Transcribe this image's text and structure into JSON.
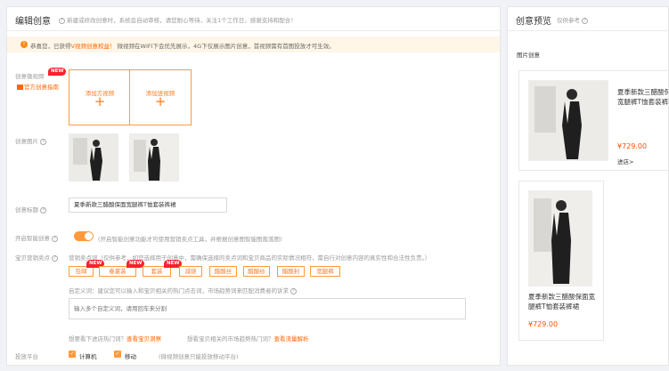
{
  "left": {
    "title": "编辑创意",
    "desc": "新建或修改创意时，系统会自动审核，请您耐心等待，关注1个工作日，感谢支持和配合！",
    "notice": {
      "pre": "恭喜您，已获得",
      "vip": "V视频",
      "vip_tail": "创意权益！",
      "body": "微视频在WIFI下会优先展示，4G下仅展示图片创意，首视频需有首图投放才可生效。"
    },
    "video": {
      "label": "创意微视频",
      "badge": "NEW",
      "guide": "官方创意指南",
      "add_square": "添加方视频",
      "add_vertical": "添加竖视频",
      "plus": "+"
    },
    "images": {
      "label": "创意图片"
    },
    "title_field": {
      "label": "创意标题",
      "value": "夏季新款三醋酸保面宽腿裤T恤套装裤裙"
    },
    "smart": {
      "label": "开启智能创意",
      "desc": "(开启智能创意功能才可使用营销卖点工具，并根据创意图智能图裁落图)"
    },
    "selling": {
      "label": "宝贝营销卖点",
      "hint_label": "营销卖点词",
      "hint": "（仅供参考，如您选择用于创意中，需确保选择的卖点词和宝贝商品的实际情况相符，需自行对创意内容的真实性和合法性负责。）",
      "tags": [
        {
          "text": "包邮",
          "badge": "NEW"
        },
        {
          "text": "春夏装",
          "badge": "NEW"
        },
        {
          "text": "套装",
          "badge": "NEW"
        },
        {
          "text": "减烧",
          "badge": ""
        },
        {
          "text": "醋酸丝",
          "badge": ""
        },
        {
          "text": "醋酸纱",
          "badge": ""
        },
        {
          "text": "醋酸封",
          "badge": ""
        },
        {
          "text": "宽腿裤",
          "badge": ""
        }
      ],
      "custom_label": "自定义词：建议您可以输入和宝贝相关的热门点击词，市场趋势词来匹配消费者的诉求",
      "custom_placeholder": "输入多个自定义词，请用回车来分割",
      "more1_pre": "想要看下进店热门词？",
      "more1_link": "查看宝贝洞察",
      "more2_pre": "想看宝贝相关的市场趋势热门词？",
      "more2_link": "查看流量解析"
    },
    "platform": {
      "label": "投放平台",
      "opt1": "计算机",
      "opt2": "移动",
      "note": "(微视频创意只能投放移动平台)"
    }
  },
  "right": {
    "title": "创意预览",
    "sub": "仅供参考",
    "section": "图片创意",
    "card1": {
      "title": "夏季新款三醋酸保面宽腿裤T恤套装裤裙",
      "price": "¥729.00",
      "shop": "进店>"
    },
    "card2": {
      "title": "夏季新款三醋酸保面宽腿裤T恤套装裤裙",
      "price": "¥729.00"
    }
  },
  "colors": {
    "accent": "#ff7a1a",
    "badge": "#f5222d",
    "notice_bg": "#fff6e8"
  },
  "icons": {
    "help": "question-circle-icon",
    "notice": "exclamation-circle-icon",
    "check": "check-icon",
    "guide": "book-icon"
  }
}
